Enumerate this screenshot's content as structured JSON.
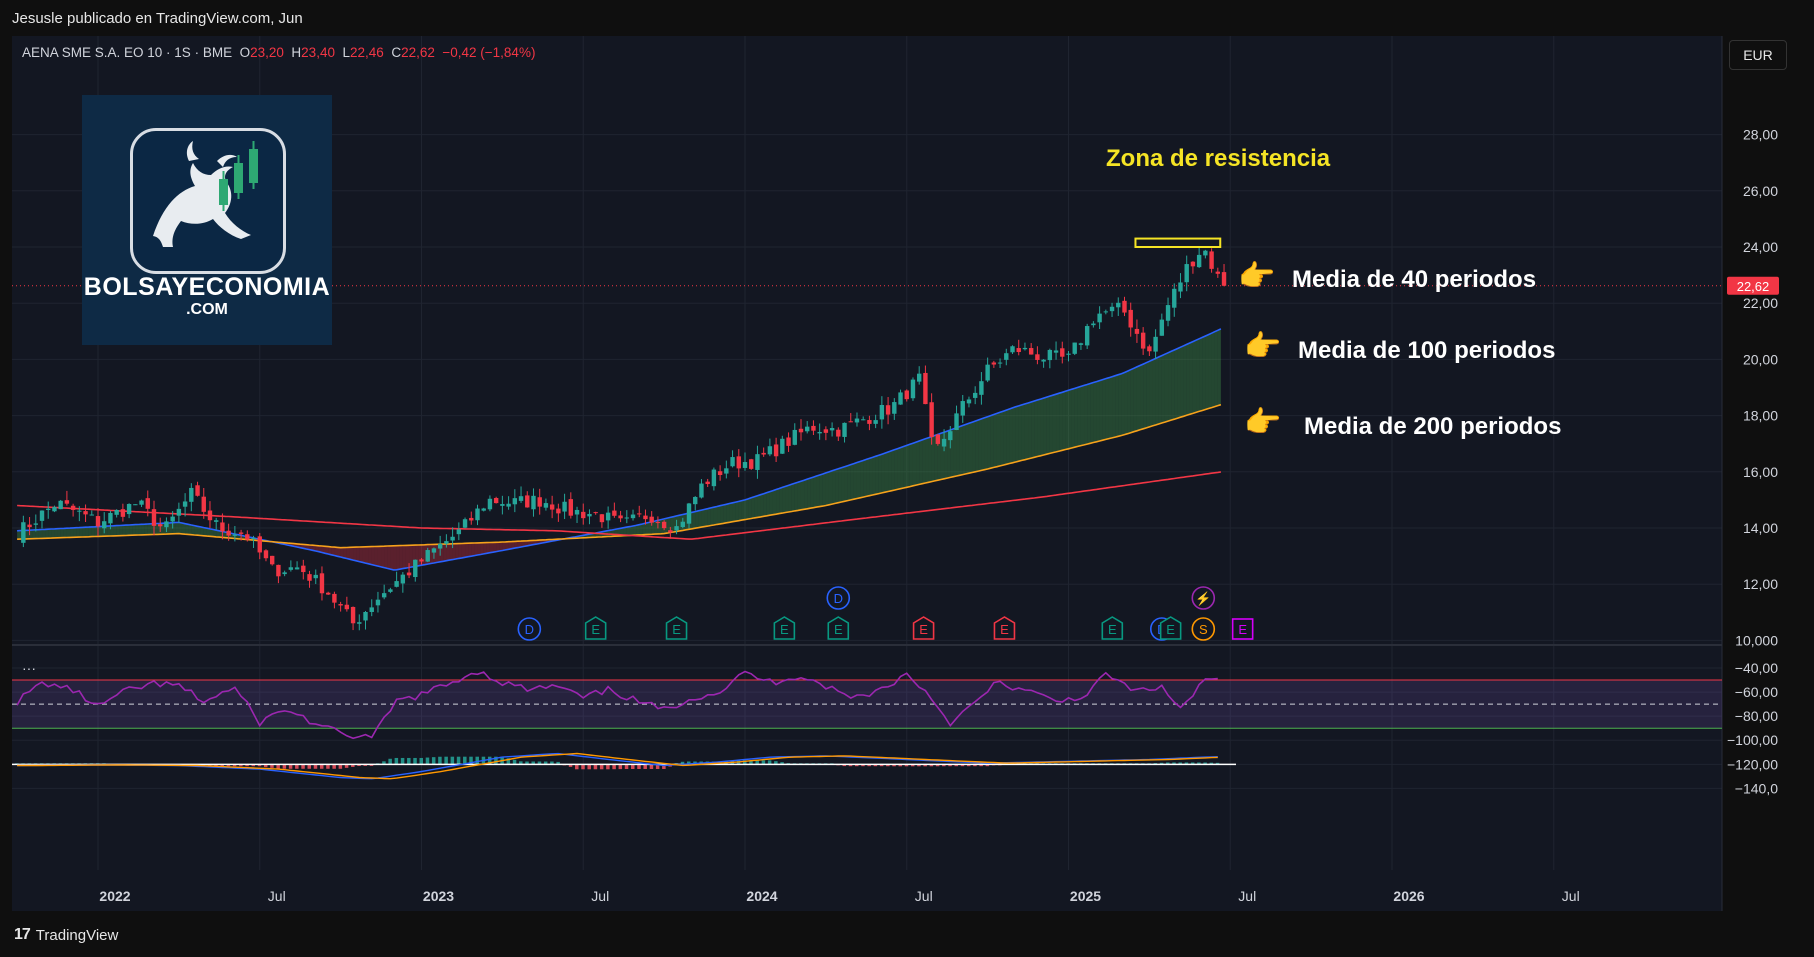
{
  "header": {
    "published_by": "Jesusle publicado en TradingView.com, Jun"
  },
  "footer": {
    "brand": "TradingView",
    "brand_mark": "17"
  },
  "legend": {
    "symbol": "AENA SME S.A. EO 10 · 1S · BME",
    "open_label": "O",
    "open": "23,20",
    "high_label": "H",
    "high": "23,40",
    "low_label": "L",
    "low": "22,46",
    "close_label": "C",
    "close": "22,62",
    "change": "−0,42 (−1,84%)"
  },
  "currency": "EUR",
  "logo": {
    "name": "BOLSAYECONOMIA",
    "domain": ".COM"
  },
  "annotations": {
    "resistance": "Zona de resistencia",
    "ma40": "Media de 40 periodos",
    "ma100": "Media de 100 periodos",
    "ma200": "Media de 200 periodos",
    "hand_glyph": "👉"
  },
  "indicator_pane": {
    "menu": "···"
  },
  "colors": {
    "background": "#131722",
    "up": "#26a69a",
    "down": "#f23645",
    "ma40": "#2962ff",
    "ma100": "#f7a21b",
    "ma200": "#f23645",
    "rsi": "#9c27b0",
    "resistance": "#f5e425"
  },
  "chart_data": [
    {
      "type": "candlestick",
      "title": "AENA SME S.A. EO 10 · 1S · BME",
      "price_axis": {
        "ticks": [
          "28,00",
          "26,00",
          "24,00",
          "22,00",
          "20,00",
          "18,00",
          "16,00",
          "14,00",
          "12,00",
          "10,000"
        ],
        "ylim": [
          8.5,
          28.6
        ]
      },
      "time_axis": [
        "2022",
        "Jul",
        "2023",
        "Jul",
        "2024",
        "Jul",
        "2025",
        "Jul",
        "2026",
        "Jul"
      ],
      "last_price": {
        "label": "22,62",
        "value": 22.62
      },
      "close_anchors": [
        [
          "2021-10-01",
          13.8
        ],
        [
          "2021-11-15",
          14.9
        ],
        [
          "2022-01-01",
          14.2
        ],
        [
          "2022-02-15",
          14.9
        ],
        [
          "2022-03-15",
          13.9
        ],
        [
          "2022-04-15",
          15.2
        ],
        [
          "2022-05-15",
          14.0
        ],
        [
          "2022-06-15",
          13.8
        ],
        [
          "2022-07-15",
          12.5
        ],
        [
          "2022-08-15",
          12.6
        ],
        [
          "2022-09-15",
          11.8
        ],
        [
          "2022-10-15",
          10.6
        ],
        [
          "2022-11-15",
          11.6
        ],
        [
          "2022-12-15",
          12.4
        ],
        [
          "2023-01-15",
          13.2
        ],
        [
          "2023-02-15",
          13.9
        ],
        [
          "2023-03-15",
          15.0
        ],
        [
          "2023-04-15",
          14.9
        ],
        [
          "2023-05-15",
          15.0
        ],
        [
          "2023-06-15",
          14.6
        ],
        [
          "2023-07-15",
          14.5
        ],
        [
          "2023-08-15",
          14.1
        ],
        [
          "2023-09-15",
          14.5
        ],
        [
          "2023-10-15",
          14.0
        ],
        [
          "2023-11-15",
          15.6
        ],
        [
          "2023-12-15",
          16.3
        ],
        [
          "2024-01-15",
          16.4
        ],
        [
          "2024-02-15",
          17.0
        ],
        [
          "2024-03-15",
          17.6
        ],
        [
          "2024-04-15",
          17.5
        ],
        [
          "2024-05-15",
          17.9
        ],
        [
          "2024-06-15",
          18.3
        ],
        [
          "2024-07-15",
          19.3
        ],
        [
          "2024-08-01",
          16.6
        ],
        [
          "2024-09-01",
          18.2
        ],
        [
          "2024-10-01",
          19.6
        ],
        [
          "2024-11-01",
          20.4
        ],
        [
          "2024-12-01",
          20.1
        ],
        [
          "2025-01-01",
          20.0
        ],
        [
          "2025-02-01",
          21.6
        ],
        [
          "2025-03-01",
          21.8
        ],
        [
          "2025-04-01",
          20.2
        ],
        [
          "2025-04-20",
          21.8
        ],
        [
          "2025-05-15",
          23.4
        ],
        [
          "2025-06-01",
          24.0
        ],
        [
          "2025-06-22",
          22.62
        ]
      ],
      "moving_averages": [
        {
          "name": "Media de 40 periodos",
          "period": 40,
          "anchors": [
            [
              "2021-10-01",
              13.9
            ],
            [
              "2022-04-01",
              14.2
            ],
            [
              "2022-09-01",
              13.2
            ],
            [
              "2022-12-01",
              12.5
            ],
            [
              "2023-04-01",
              13.2
            ],
            [
              "2023-09-01",
              14.1
            ],
            [
              "2024-01-01",
              15.0
            ],
            [
              "2024-06-01",
              16.6
            ],
            [
              "2024-11-01",
              18.3
            ],
            [
              "2025-03-01",
              19.5
            ],
            [
              "2025-06-22",
              21.1
            ]
          ]
        },
        {
          "name": "Media de 100 periodos",
          "period": 100,
          "anchors": [
            [
              "2021-10-01",
              13.6
            ],
            [
              "2022-04-01",
              13.8
            ],
            [
              "2022-10-01",
              13.3
            ],
            [
              "2023-04-01",
              13.5
            ],
            [
              "2023-10-01",
              13.8
            ],
            [
              "2024-04-01",
              14.8
            ],
            [
              "2024-10-01",
              16.1
            ],
            [
              "2025-03-01",
              17.3
            ],
            [
              "2025-06-22",
              18.4
            ]
          ]
        },
        {
          "name": "Media de 200 periodos",
          "period": 200,
          "anchors": [
            [
              "2021-10-01",
              14.8
            ],
            [
              "2022-06-01",
              14.4
            ],
            [
              "2023-01-01",
              14.0
            ],
            [
              "2023-06-01",
              13.9
            ],
            [
              "2023-11-01",
              13.6
            ],
            [
              "2024-05-01",
              14.3
            ],
            [
              "2024-12-01",
              15.1
            ],
            [
              "2025-06-22",
              16.0
            ]
          ]
        }
      ],
      "resistance_zone": {
        "label": "Zona de resistencia",
        "low": 24.0,
        "high": 24.3,
        "from": "2025-02-01",
        "to": "2025-07-01"
      },
      "events": [
        {
          "symbol": "D",
          "date": "2023-05-01",
          "row": 1,
          "kind": "dividend"
        },
        {
          "symbol": "E",
          "date": "2023-07-15",
          "row": 1,
          "kind": "earnings-up"
        },
        {
          "symbol": "E",
          "date": "2023-10-15",
          "row": 1,
          "kind": "earnings-up"
        },
        {
          "symbol": "D",
          "date": "2024-04-15",
          "row": 0,
          "kind": "dividend"
        },
        {
          "symbol": "E",
          "date": "2024-02-15",
          "row": 1,
          "kind": "earnings-up"
        },
        {
          "symbol": "E",
          "date": "2024-04-15",
          "row": 1,
          "kind": "earnings-up"
        },
        {
          "symbol": "E",
          "date": "2024-07-20",
          "row": 1,
          "kind": "earnings-down"
        },
        {
          "symbol": "E",
          "date": "2024-10-20",
          "row": 1,
          "kind": "earnings-down"
        },
        {
          "symbol": "E",
          "date": "2025-02-20",
          "row": 1,
          "kind": "earnings-up"
        },
        {
          "symbol": "D",
          "date": "2025-04-15",
          "row": 1,
          "kind": "dividend"
        },
        {
          "symbol": "E",
          "date": "2025-04-25",
          "row": 1,
          "kind": "earnings-up"
        },
        {
          "symbol": "S",
          "date": "2025-06-01",
          "row": 1,
          "kind": "split"
        },
        {
          "symbol": "⚡",
          "date": "2025-06-01",
          "row": 0,
          "kind": "news"
        },
        {
          "symbol": "E",
          "date": "2025-07-15",
          "row": 1,
          "kind": "earnings-future"
        }
      ]
    },
    {
      "type": "line",
      "title": "",
      "y_axis": {
        "ticks": [
          "−40,00",
          "−60,00",
          "−80,00",
          "−100,00",
          "−120,00",
          "−140,0"
        ],
        "ylim": [
          -148,
          -34
        ]
      },
      "rsi_band": {
        "upper": -50,
        "middle": -70,
        "lower": -90
      },
      "rsi_anchors": [
        [
          2021.75,
          -68
        ],
        [
          2021.83,
          -52
        ],
        [
          2021.92,
          -58
        ],
        [
          2022.0,
          -72
        ],
        [
          2022.08,
          -60
        ],
        [
          2022.17,
          -53
        ],
        [
          2022.25,
          -55
        ],
        [
          2022.33,
          -68
        ],
        [
          2022.42,
          -56
        ],
        [
          2022.5,
          -85
        ],
        [
          2022.58,
          -74
        ],
        [
          2022.67,
          -86
        ],
        [
          2022.75,
          -95
        ],
        [
          2022.85,
          -98
        ],
        [
          2022.92,
          -68
        ],
        [
          2023.0,
          -62
        ],
        [
          2023.08,
          -54
        ],
        [
          2023.17,
          -42
        ],
        [
          2023.25,
          -52
        ],
        [
          2023.33,
          -58
        ],
        [
          2023.42,
          -55
        ],
        [
          2023.5,
          -65
        ],
        [
          2023.58,
          -58
        ],
        [
          2023.67,
          -68
        ],
        [
          2023.75,
          -75
        ],
        [
          2023.83,
          -65
        ],
        [
          2023.92,
          -60
        ],
        [
          2024.0,
          -44
        ],
        [
          2024.08,
          -52
        ],
        [
          2024.17,
          -46
        ],
        [
          2024.25,
          -55
        ],
        [
          2024.33,
          -65
        ],
        [
          2024.42,
          -58
        ],
        [
          2024.5,
          -45
        ],
        [
          2024.58,
          -65
        ],
        [
          2024.63,
          -86
        ],
        [
          2024.7,
          -72
        ],
        [
          2024.78,
          -52
        ],
        [
          2024.88,
          -60
        ],
        [
          2024.96,
          -68
        ],
        [
          2025.06,
          -62
        ],
        [
          2025.12,
          -44
        ],
        [
          2025.2,
          -60
        ],
        [
          2025.28,
          -55
        ],
        [
          2025.35,
          -74
        ],
        [
          2025.42,
          -50
        ],
        [
          2025.48,
          -52
        ],
        [
          2025.51,
          -65
        ],
        [
          2025.54,
          -69
        ]
      ],
      "macd_anchors": [
        [
          2021.75,
          -121
        ],
        [
          2022.0,
          -120.5
        ],
        [
          2022.25,
          -121
        ],
        [
          2022.5,
          -124
        ],
        [
          2022.75,
          -131
        ],
        [
          2022.85,
          -132
        ],
        [
          2023.0,
          -126
        ],
        [
          2023.25,
          -114
        ],
        [
          2023.42,
          -111
        ],
        [
          2023.58,
          -116
        ],
        [
          2023.75,
          -121
        ],
        [
          2023.92,
          -118
        ],
        [
          2024.08,
          -114
        ],
        [
          2024.25,
          -113
        ],
        [
          2024.42,
          -115
        ],
        [
          2024.58,
          -117
        ],
        [
          2024.75,
          -119
        ],
        [
          2024.92,
          -118
        ],
        [
          2025.08,
          -117
        ],
        [
          2025.25,
          -116
        ],
        [
          2025.42,
          -114
        ],
        [
          2025.54,
          -113
        ]
      ]
    }
  ]
}
